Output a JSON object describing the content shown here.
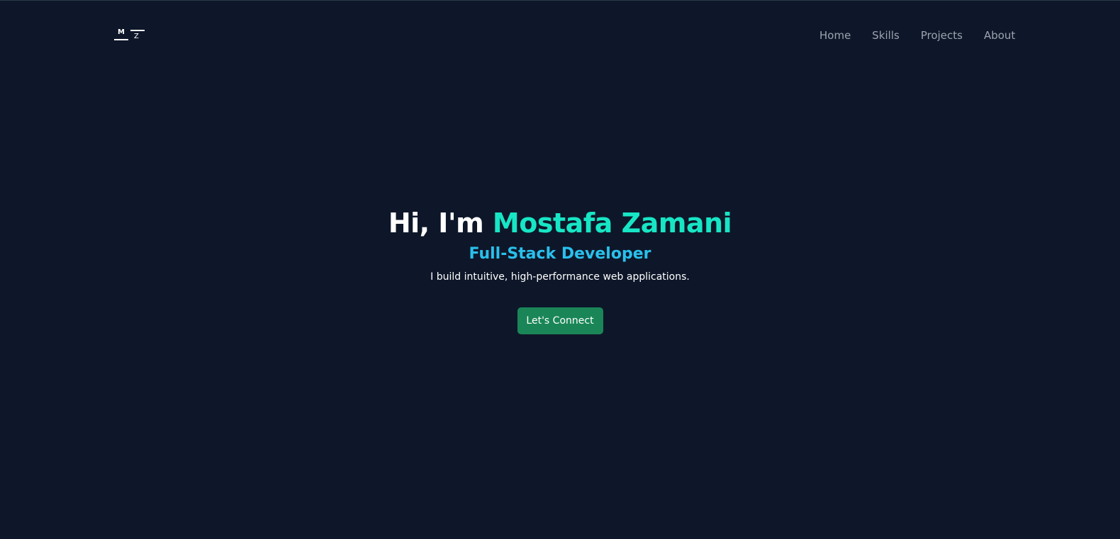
{
  "logo": {
    "letter_top": "M",
    "letter_bottom": "Z"
  },
  "nav": {
    "items": [
      {
        "label": "Home"
      },
      {
        "label": "Skills"
      },
      {
        "label": "Projects"
      },
      {
        "label": "About"
      }
    ]
  },
  "hero": {
    "greeting": "Hi, I'm ",
    "name": "Mostafa Zamani",
    "subtitle": "Full-Stack Developer",
    "description": "I build intuitive, high-performance web applications.",
    "cta_label": "Let's Connect"
  },
  "colors": {
    "background": "#0e1729",
    "accent_name": "#17e6c5",
    "accent_subtitle": "#29c0ec",
    "cta_background": "#1a8657",
    "nav_text": "#9ca3af"
  }
}
